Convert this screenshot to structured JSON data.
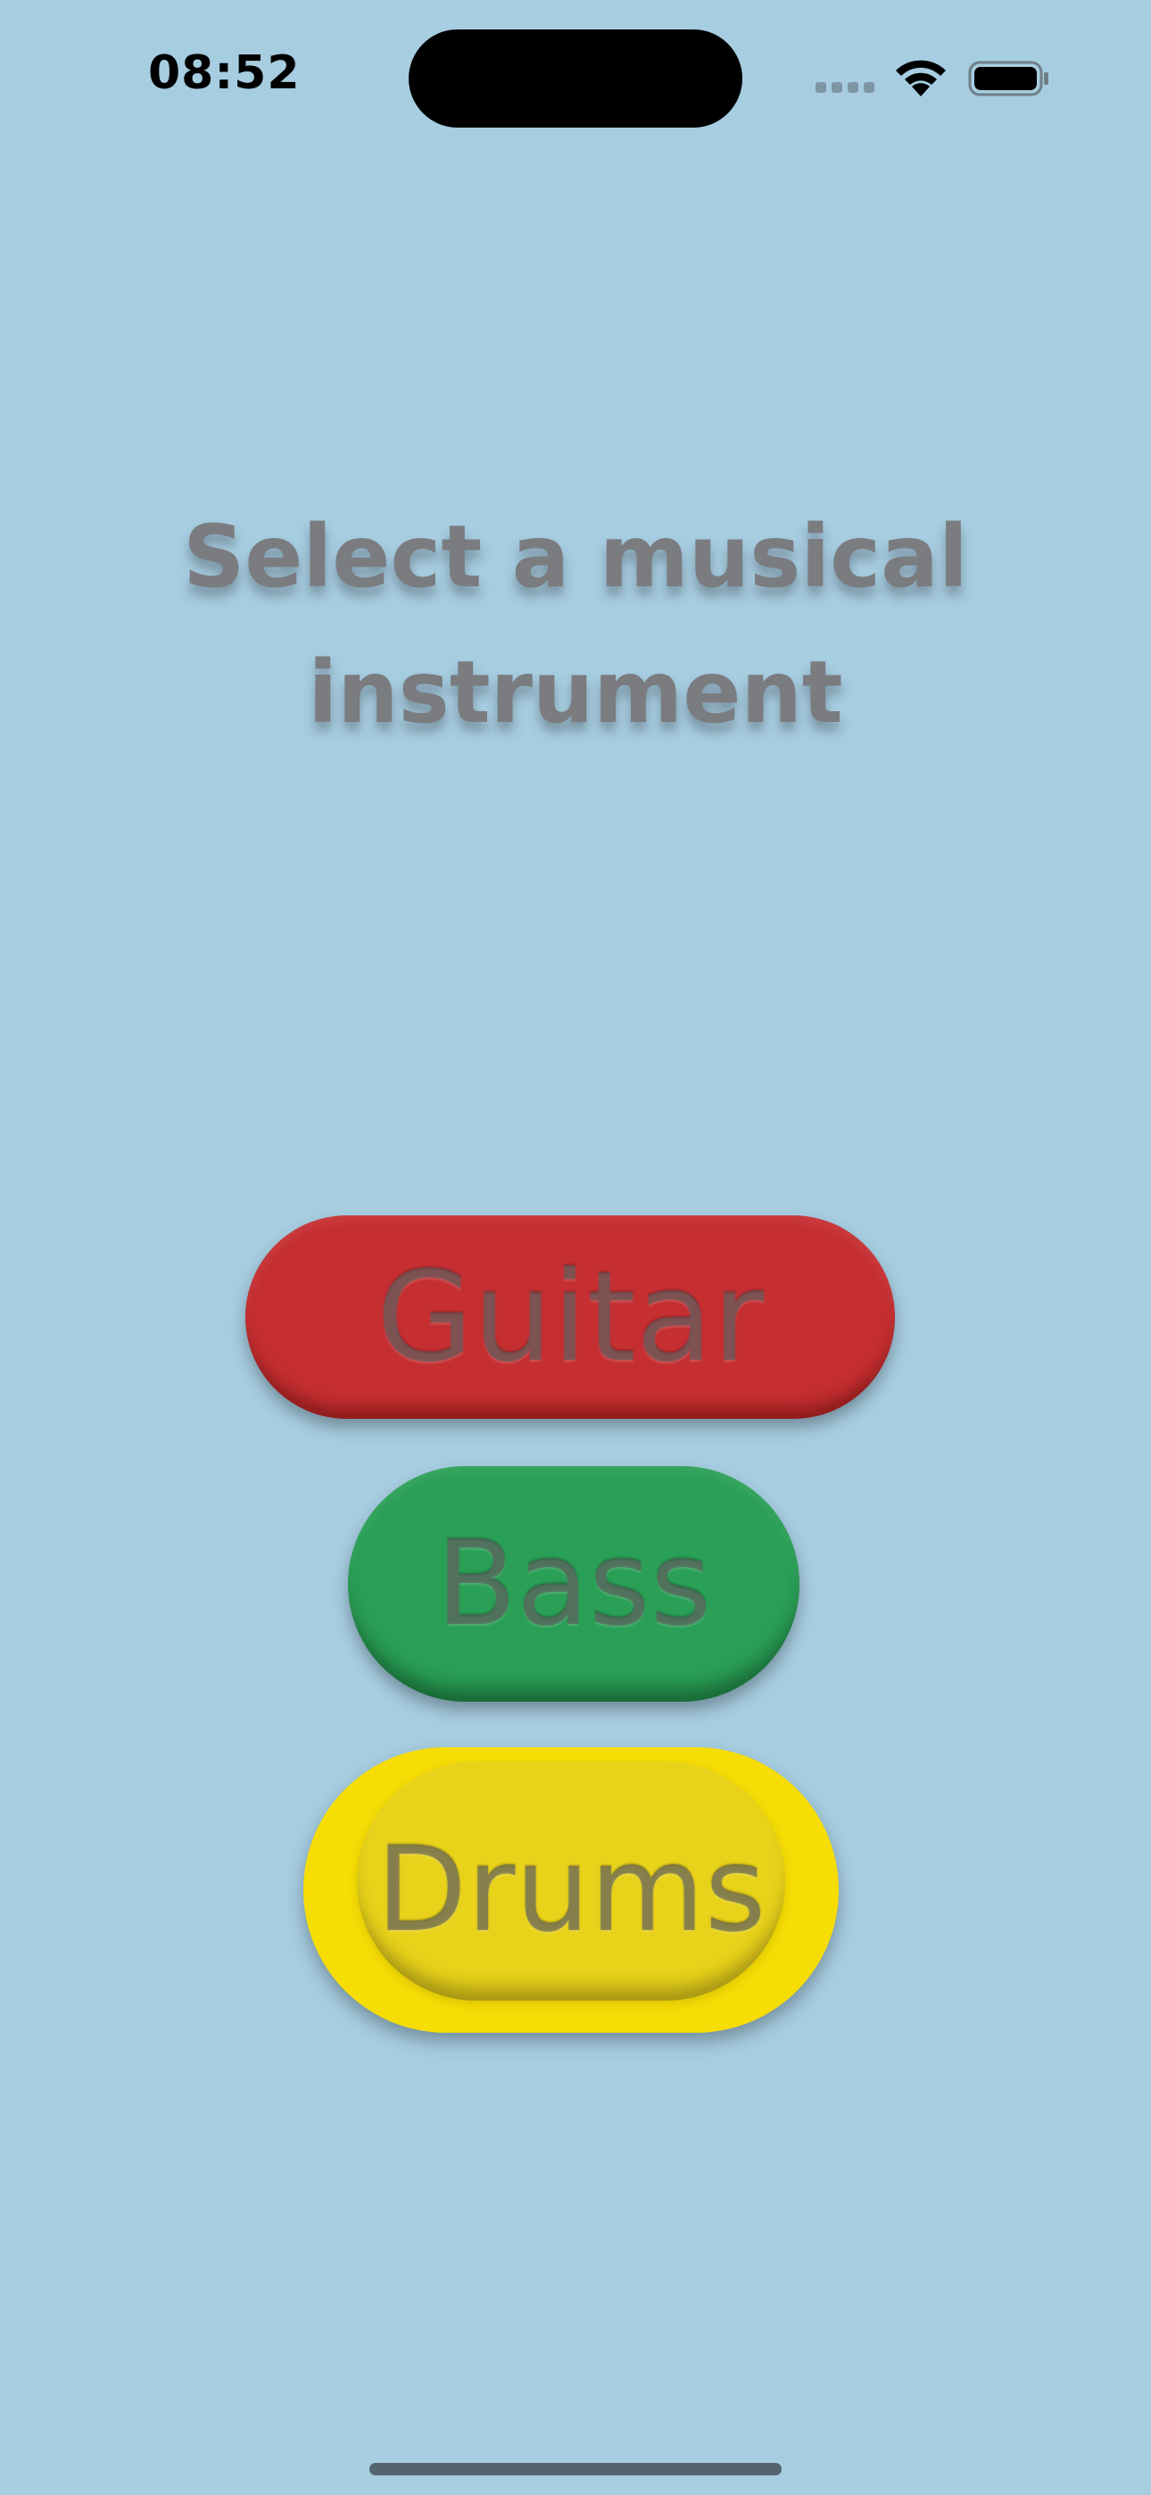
{
  "status_bar": {
    "time": "08:52",
    "icons": [
      "cellular-signal-icon",
      "wifi-icon",
      "battery-icon"
    ]
  },
  "title": {
    "line1": "Select a musical",
    "line2": "instrument"
  },
  "instruments": [
    {
      "label": "Guitar",
      "color": "#c52f32"
    },
    {
      "label": "Bass",
      "color": "#2a9f56"
    },
    {
      "label": "Drums",
      "color": "#f6dd06"
    }
  ],
  "theme": {
    "background": "#a6cde0",
    "title_color": "#7a7c80"
  }
}
